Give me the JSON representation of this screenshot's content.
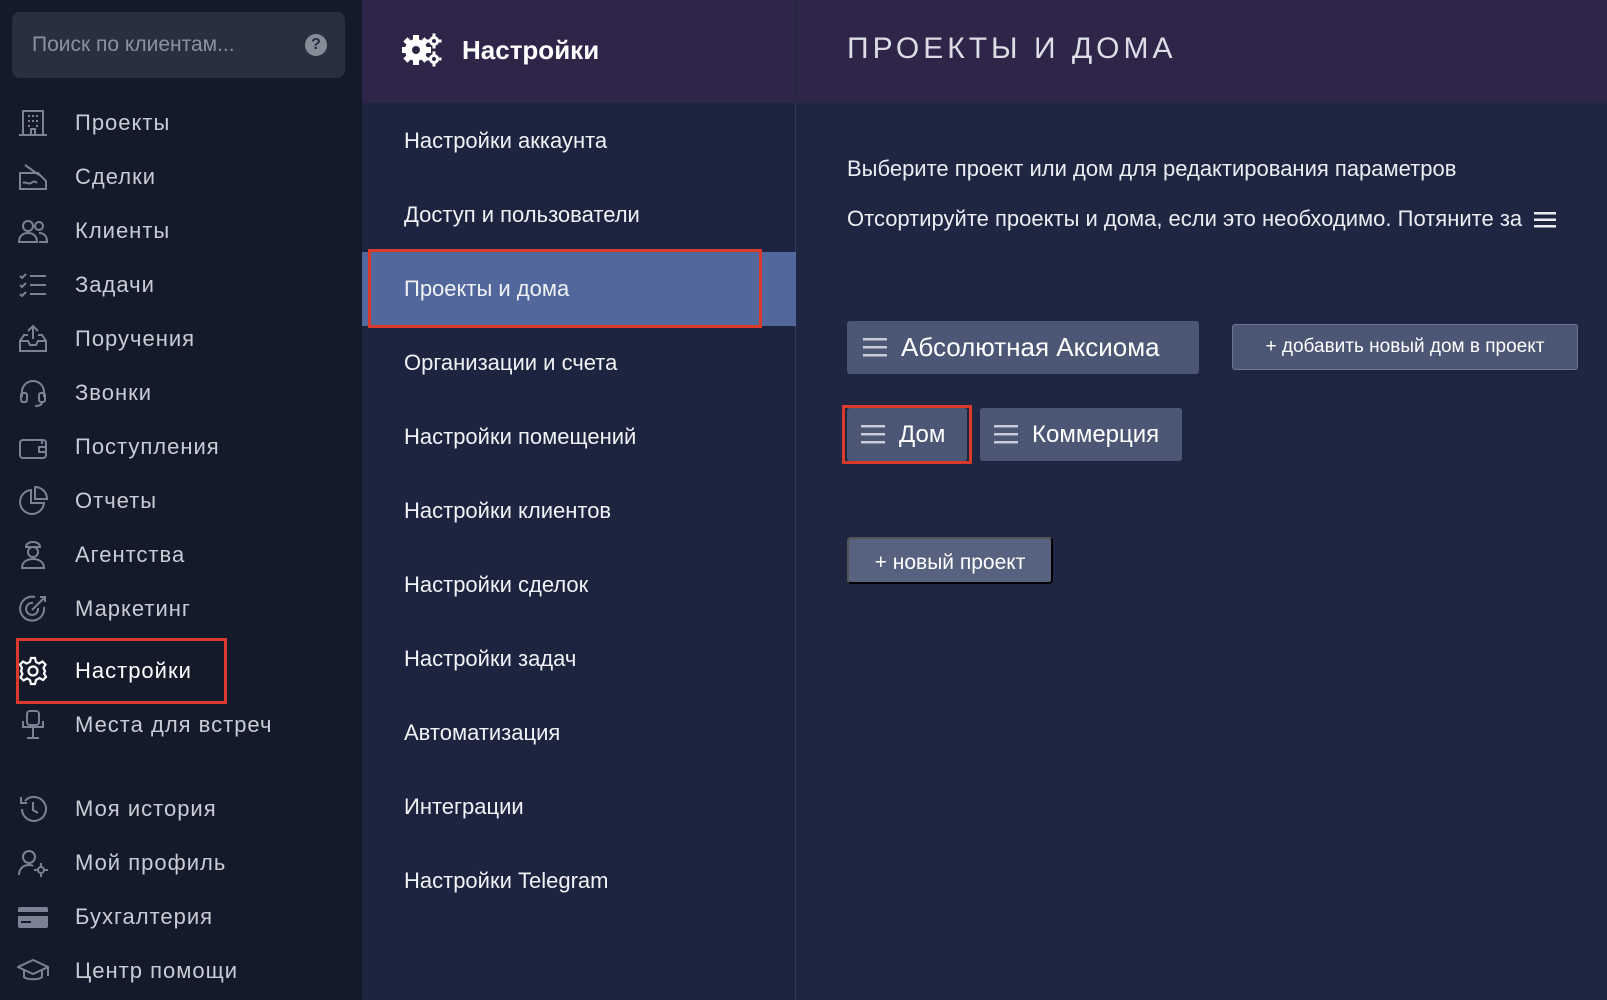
{
  "search": {
    "placeholder": "Поиск по клиентам..."
  },
  "sidebar": {
    "items": [
      {
        "label": "Проекты",
        "icon": "building-icon"
      },
      {
        "label": "Сделки",
        "icon": "contract-icon"
      },
      {
        "label": "Клиенты",
        "icon": "users-icon"
      },
      {
        "label": "Задачи",
        "icon": "tasks-icon"
      },
      {
        "label": "Поручения",
        "icon": "tray-upload-icon"
      },
      {
        "label": "Звонки",
        "icon": "headset-icon"
      },
      {
        "label": "Поступления",
        "icon": "wallet-icon"
      },
      {
        "label": "Отчеты",
        "icon": "pie-chart-icon"
      },
      {
        "label": "Агентства",
        "icon": "agent-icon"
      },
      {
        "label": "Маркетинг",
        "icon": "target-icon"
      },
      {
        "label": "Настройки",
        "icon": "gear-icon"
      },
      {
        "label": "Места для встреч",
        "icon": "chair-icon"
      },
      {
        "label": "Моя история",
        "icon": "history-icon"
      },
      {
        "label": "Мой профиль",
        "icon": "user-settings-icon"
      },
      {
        "label": "Бухгалтерия",
        "icon": "credit-card-icon"
      },
      {
        "label": "Центр помощи",
        "icon": "graduation-cap-icon"
      }
    ],
    "active": "Настройки"
  },
  "settings_menu": {
    "title": "Настройки",
    "items": [
      "Настройки аккаунта",
      "Доступ и пользователи",
      "Проекты и дома",
      "Организации и счета",
      "Настройки помещений",
      "Настройки клиентов",
      "Настройки сделок",
      "Настройки задач",
      "Автоматизация",
      "Интеграции",
      "Настройки Telegram"
    ],
    "active": "Проекты и дома"
  },
  "main": {
    "title": "ПРОЕКТЫ И ДОМА",
    "instruction1": "Выберите проект или дом для редактирования параметров",
    "instruction2": "Отсортируйте проекты и дома, если это необходимо. Потяните за",
    "project": {
      "name": "Абсолютная Аксиома"
    },
    "add_house_label": "+ добавить новый дом в проект",
    "houses": [
      "Дом",
      "Коммерция"
    ],
    "new_project_label": "+ новый проект"
  },
  "colors": {
    "sidebar_bg": "#151a2b",
    "panel_bg": "#1e2642",
    "header_bg": "#2e2549",
    "active_menu": "#52679c",
    "chip_bg": "#4c5776",
    "highlight": "#d93a2b"
  }
}
